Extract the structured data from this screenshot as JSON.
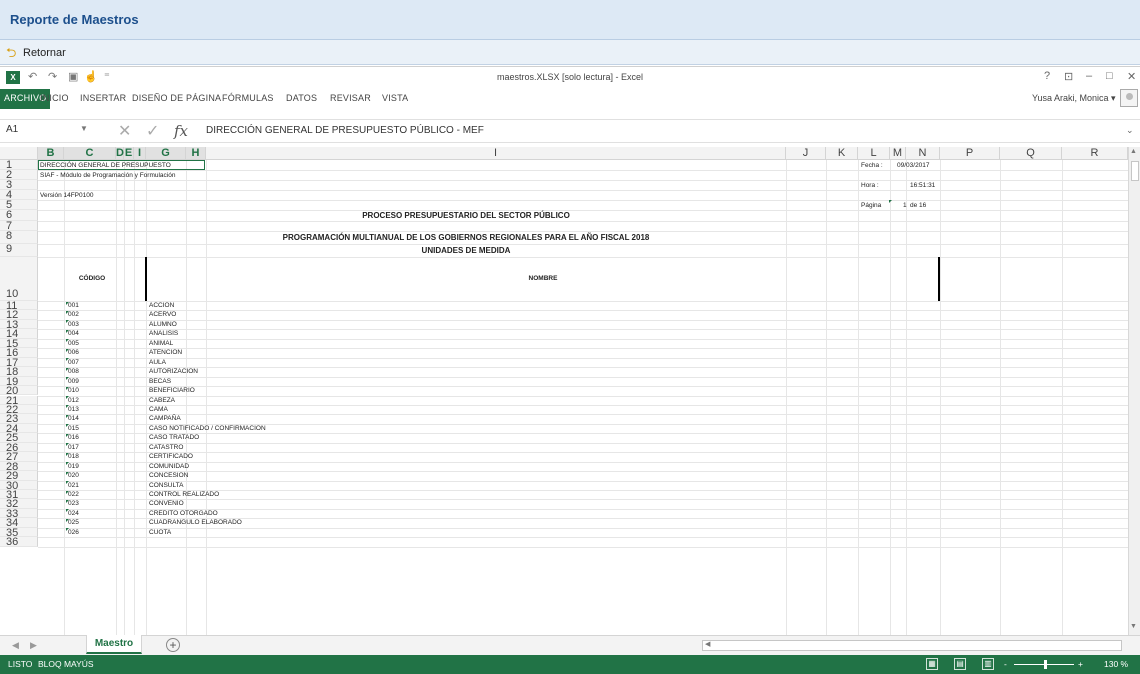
{
  "app": {
    "title": "Reporte de Maestros",
    "back_label": "Retornar"
  },
  "excel": {
    "logo": "X",
    "doc_title": "maestros.XLSX  [solo lectura] - Excel",
    "window_controls": {
      "help": "?",
      "restore_ribbon": "⊡",
      "minimize": "–",
      "maximize": "□",
      "close": "✕"
    },
    "ribbon_tabs": [
      "ARCHIVO",
      "INICIO",
      "INSERTAR",
      "DISEÑO DE PÁGINA",
      "FÓRMULAS",
      "DATOS",
      "REVISAR",
      "VISTA"
    ],
    "user": "Yusa Araki, Monica ▾",
    "name_box": "A1",
    "formula": "DIRECCIÓN GENERAL DE PRESUPUESTO PÚBLICO - MEF",
    "columns": [
      "B",
      "C",
      "D",
      "E",
      "I",
      "G",
      "H",
      "I",
      "J",
      "K",
      "L",
      "M",
      "N",
      "P",
      "Q",
      "R"
    ],
    "rows": [
      "1",
      "2",
      "3",
      "4",
      "5",
      "6",
      "7",
      "8",
      "9",
      "10",
      "11",
      "12",
      "13",
      "14",
      "15",
      "16",
      "17",
      "18",
      "19",
      "20",
      "21",
      "22",
      "23",
      "24",
      "25",
      "26",
      "27",
      "28",
      "29",
      "30",
      "31",
      "32",
      "33",
      "34",
      "35",
      "36"
    ],
    "header_cells": {
      "b1": "DIRECCIÓN GENERAL DE PRESUPUESTO",
      "b2": "SIAF - Módulo de Programación y Formulación",
      "b4": "Versión 14FP0100",
      "fecha_label": "Fecha :",
      "fecha_value": "09/03/2017",
      "hora_label": "Hora :",
      "hora_value": "16:51:31",
      "pagina_label": "Página",
      "pagina_num": "1",
      "pagina_of": "de 16",
      "title1": "PROCESO PRESUPUESTARIO DEL SECTOR PÚBLICO",
      "title2": "PROGRAMACIÓN MULTIANUAL DE LOS GOBIERNOS REGIONALES PARA EL AÑO FISCAL 2018",
      "title3": "UNIDADES DE MEDIDA",
      "col_codigo": "CÓDIGO",
      "col_nombre": "NOMBRE"
    },
    "data_rows": [
      {
        "code": "001",
        "name": "ACCION"
      },
      {
        "code": "002",
        "name": "ACERVO"
      },
      {
        "code": "003",
        "name": "ALUMNO"
      },
      {
        "code": "004",
        "name": "ANALISIS"
      },
      {
        "code": "005",
        "name": "ANIMAL"
      },
      {
        "code": "006",
        "name": "ATENCION"
      },
      {
        "code": "007",
        "name": "AULA"
      },
      {
        "code": "008",
        "name": "AUTORIZACION"
      },
      {
        "code": "009",
        "name": "BECAS"
      },
      {
        "code": "010",
        "name": "BENEFICIARIO"
      },
      {
        "code": "012",
        "name": "CABEZA"
      },
      {
        "code": "013",
        "name": "CAMA"
      },
      {
        "code": "014",
        "name": "CAMPAÑA"
      },
      {
        "code": "015",
        "name": "CASO NOTIFICADO / CONFIRMACION"
      },
      {
        "code": "016",
        "name": "CASO TRATADO"
      },
      {
        "code": "017",
        "name": "CATASTRO"
      },
      {
        "code": "018",
        "name": "CERTIFICADO"
      },
      {
        "code": "019",
        "name": "COMUNIDAD"
      },
      {
        "code": "020",
        "name": "CONCESION"
      },
      {
        "code": "021",
        "name": "CONSULTA"
      },
      {
        "code": "022",
        "name": "CONTROL REALIZADO"
      },
      {
        "code": "023",
        "name": "CONVENIO"
      },
      {
        "code": "024",
        "name": "CREDITO OTORGADO"
      },
      {
        "code": "025",
        "name": "CUADRANGULO ELABORADO"
      },
      {
        "code": "026",
        "name": "CUOTA"
      }
    ],
    "sheet_tab": "Maestro",
    "add_sheet": "+",
    "status": {
      "mode": "LISTO",
      "caps": "BLOQ MAYÚS",
      "zoom": "130 %",
      "zoom_minus": "-",
      "zoom_plus": "+"
    }
  },
  "colors": {
    "excel_green": "#217346",
    "app_title": "#1c4f8c"
  }
}
